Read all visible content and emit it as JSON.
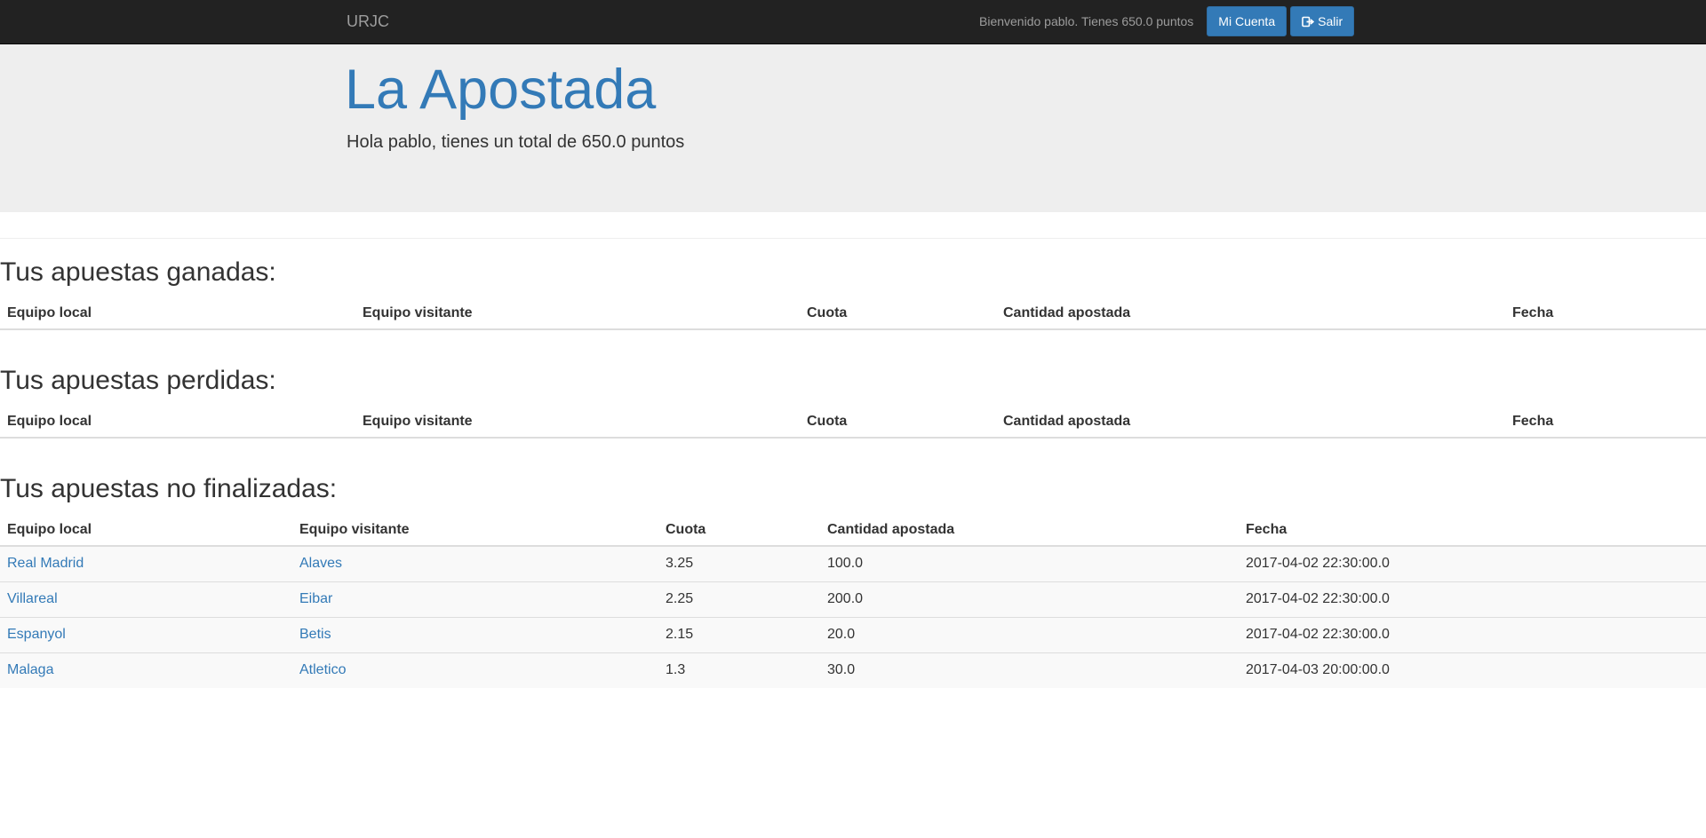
{
  "navbar": {
    "brand": "URJC",
    "welcome": "Bienvenido pablo. Tienes 650.0 puntos",
    "account_label": "Mi Cuenta",
    "logout_label": "Salir"
  },
  "jumbotron": {
    "title": "La Apostada",
    "subtitle": "Hola pablo, tienes un total de 650.0 puntos"
  },
  "columns": [
    "Equipo local",
    "Equipo visitante",
    "Cuota",
    "Cantidad apostada",
    "Fecha"
  ],
  "won": {
    "heading": "Tus apuestas ganadas:",
    "rows": []
  },
  "lost": {
    "heading": "Tus apuestas perdidas:",
    "rows": []
  },
  "pending": {
    "heading": "Tus apuestas no finalizadas:",
    "rows": [
      {
        "local": "Real Madrid",
        "visitor": "Alaves",
        "odds": "3.25",
        "amount": "100.0",
        "date": "2017-04-02 22:30:00.0"
      },
      {
        "local": "Villareal",
        "visitor": "Eibar",
        "odds": "2.25",
        "amount": "200.0",
        "date": "2017-04-02 22:30:00.0"
      },
      {
        "local": "Espanyol",
        "visitor": "Betis",
        "odds": "2.15",
        "amount": "20.0",
        "date": "2017-04-02 22:30:00.0"
      },
      {
        "local": "Malaga",
        "visitor": "Atletico",
        "odds": "1.3",
        "amount": "30.0",
        "date": "2017-04-03 20:00:00.0"
      }
    ]
  },
  "colors": {
    "primary": "#337ab7",
    "navbar": "#222222",
    "jumbotron": "#eeeeee"
  },
  "icons": {
    "logout": "sign-out-icon"
  }
}
